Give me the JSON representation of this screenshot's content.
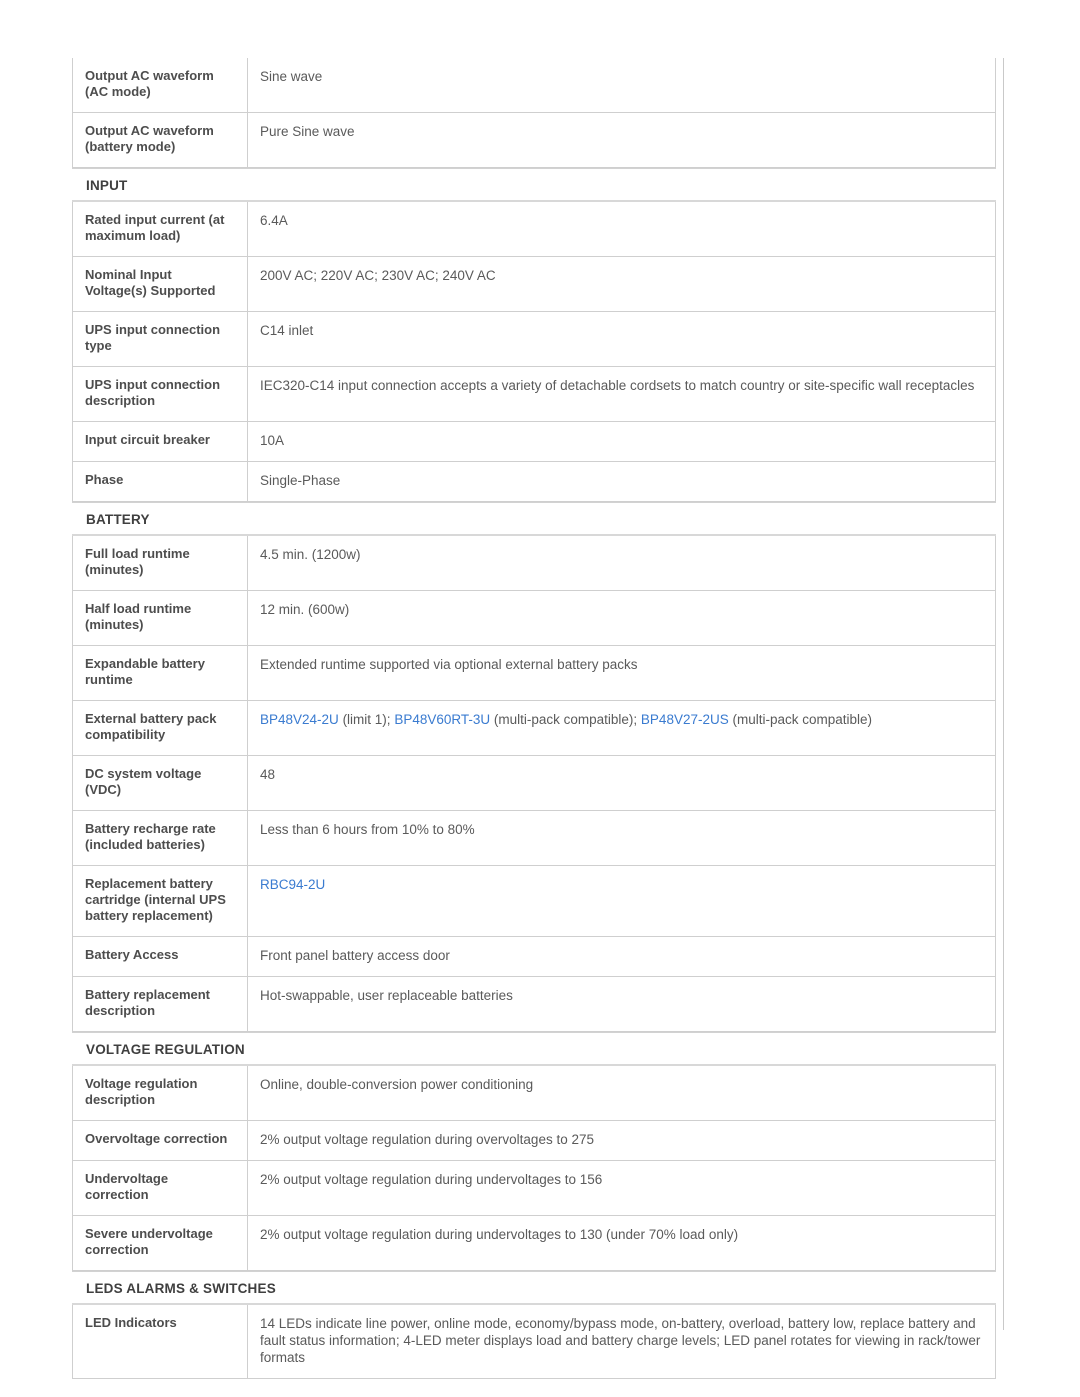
{
  "document": {
    "type": "product-specification-table",
    "link_color": "#3a7bd0",
    "label_color": "#4d4d4d",
    "value_color": "#5a5a5a"
  },
  "table": {
    "rows": [
      {
        "kind": "spec",
        "label": "Output AC waveform (AC mode)",
        "value": "Sine wave"
      },
      {
        "kind": "spec",
        "label": "Output AC waveform (battery mode)",
        "value": "Pure Sine wave"
      },
      {
        "kind": "section",
        "label": "INPUT"
      },
      {
        "kind": "spec",
        "label": "Rated input current (at maximum load)",
        "value": "6.4A"
      },
      {
        "kind": "spec",
        "label": "Nominal Input Voltage(s) Supported",
        "value": "200V AC; 220V AC; 230V AC; 240V AC"
      },
      {
        "kind": "spec",
        "label": "UPS input connection type",
        "value": "C14 inlet"
      },
      {
        "kind": "spec",
        "label": "UPS input connection description",
        "value": "IEC320-C14 input connection accepts a variety of detachable cordsets to match country or site-specific wall receptacles"
      },
      {
        "kind": "spec",
        "label": "Input circuit breaker",
        "value": "10A"
      },
      {
        "kind": "spec",
        "label": "Phase",
        "value": "Single-Phase"
      },
      {
        "kind": "section",
        "label": "BATTERY"
      },
      {
        "kind": "spec",
        "label": "Full load runtime (minutes)",
        "value": "4.5 min. (1200w)"
      },
      {
        "kind": "spec",
        "label": "Half load runtime (minutes)",
        "value": "12 min. (600w)"
      },
      {
        "kind": "spec",
        "label": "Expandable battery runtime",
        "value": "Extended runtime supported via optional external battery packs"
      },
      {
        "kind": "spec-rich",
        "label": "External battery pack compatibility",
        "parts": [
          {
            "type": "link",
            "text": "BP48V24-2U"
          },
          {
            "type": "text",
            "text": " (limit 1); "
          },
          {
            "type": "link",
            "text": "BP48V60RT-3U"
          },
          {
            "type": "text",
            "text": " (multi-pack compatible); "
          },
          {
            "type": "link",
            "text": "BP48V27-2US"
          },
          {
            "type": "text",
            "text": " (multi-pack compatible)"
          }
        ]
      },
      {
        "kind": "spec",
        "label": "DC system voltage (VDC)",
        "value": "48"
      },
      {
        "kind": "spec",
        "label": "Battery recharge rate (included batteries)",
        "value": "Less than 6 hours from 10% to 80%"
      },
      {
        "kind": "spec-rich",
        "label": "Replacement battery cartridge (internal UPS battery replacement)",
        "parts": [
          {
            "type": "link",
            "text": "RBC94-2U"
          }
        ]
      },
      {
        "kind": "spec",
        "label": "Battery Access",
        "value": "Front panel battery access door"
      },
      {
        "kind": "spec",
        "label": "Battery replacement description",
        "value": "Hot-swappable, user replaceable batteries"
      },
      {
        "kind": "section",
        "label": "VOLTAGE REGULATION"
      },
      {
        "kind": "spec",
        "label": "Voltage regulation description",
        "value": "Online, double-conversion power conditioning"
      },
      {
        "kind": "spec",
        "label": "Overvoltage correction",
        "value": "2% output voltage regulation during overvoltages to 275"
      },
      {
        "kind": "spec",
        "label": "Undervoltage correction",
        "value": "2% output voltage regulation during undervoltages to 156"
      },
      {
        "kind": "spec",
        "label": "Severe undervoltage correction",
        "value": "2% output voltage regulation during undervoltages to 130 (under 70% load only)"
      },
      {
        "kind": "section",
        "label": "LEDS ALARMS & SWITCHES"
      },
      {
        "kind": "spec",
        "label": "LED Indicators",
        "value": "14 LEDs indicate line power, online mode, economy/bypass mode, on-battery, overload, battery low, replace battery and fault status information; 4-LED meter displays load and battery charge levels; LED panel rotates for viewing in rack/tower formats"
      }
    ]
  }
}
